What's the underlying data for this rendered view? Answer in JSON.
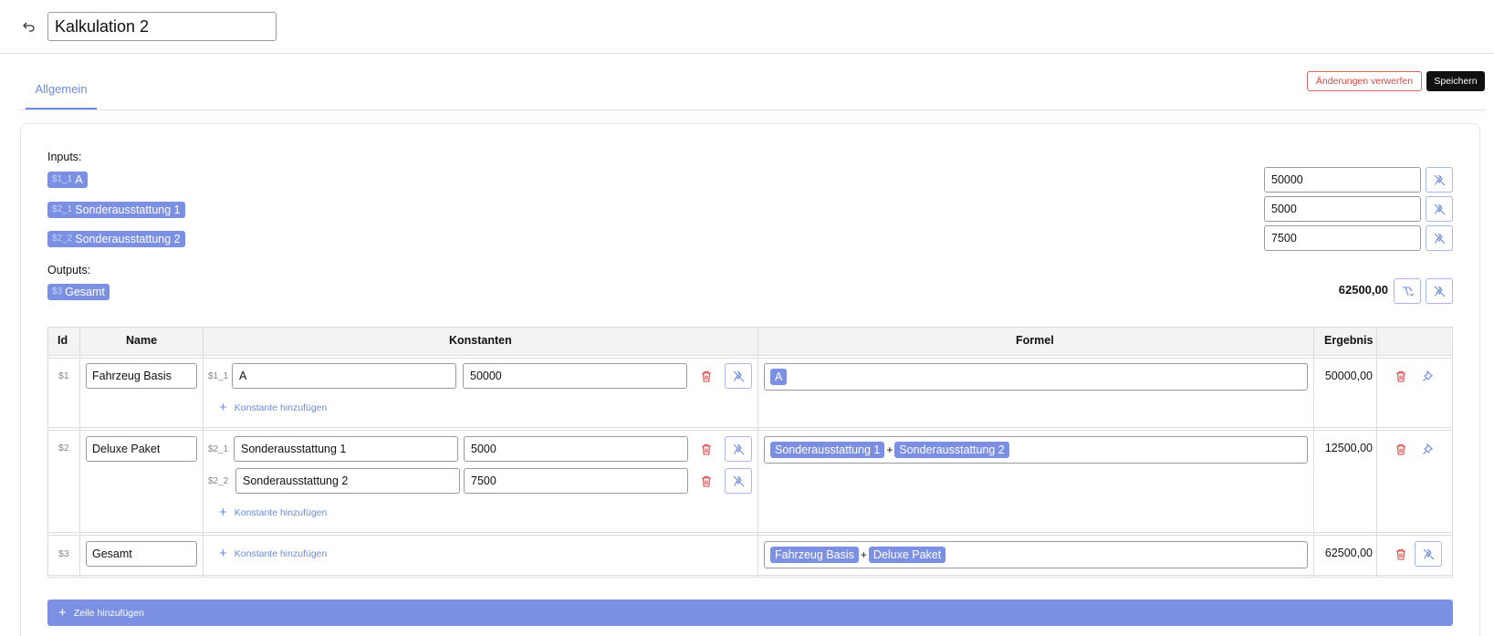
{
  "header": {
    "title_value": "Kalkulation 2"
  },
  "tabs": [
    {
      "label": "Allgemein",
      "active": true
    }
  ],
  "actions": {
    "discard_label": "Änderungen verwerfen",
    "save_label": "Speichern"
  },
  "inputs": {
    "label": "Inputs:",
    "items": [
      {
        "id": "$1_1",
        "name": "A",
        "value": "50000"
      },
      {
        "id": "$2_1",
        "name": "Sonderausstattung 1",
        "value": "5000"
      },
      {
        "id": "$2_2",
        "name": "Sonderausstattung 2",
        "value": "7500"
      }
    ]
  },
  "outputs": {
    "label": "Outputs:",
    "items": [
      {
        "id": "$3",
        "name": "Gesamt",
        "value": "62500,00"
      }
    ]
  },
  "table": {
    "columns": [
      "Id",
      "Name",
      "Konstanten",
      "Formel",
      "Ergebnis"
    ],
    "add_constant_label": "Konstante hinzufügen",
    "rows": [
      {
        "id": "$1",
        "name": "Fahrzeug Basis",
        "constants": [
          {
            "id": "$1_1",
            "name": "A",
            "value": "50000"
          }
        ],
        "formula": [
          {
            "chip": "A"
          }
        ],
        "result": "50000,00"
      },
      {
        "id": "$2",
        "name": "Deluxe Paket",
        "constants": [
          {
            "id": "$2_1",
            "name": "Sonderausstattung 1",
            "value": "5000"
          },
          {
            "id": "$2_2",
            "name": "Sonderausstattung 2",
            "value": "7500"
          }
        ],
        "formula": [
          {
            "chip": "Sonderausstattung 1"
          },
          {
            "op": "+"
          },
          {
            "chip": "Sonderausstattung 2"
          }
        ],
        "result": "12500,00"
      },
      {
        "id": "$3",
        "name": "Gesamt",
        "constants": [],
        "formula": [
          {
            "chip": "Fahrzeug Basis"
          },
          {
            "op": "+"
          },
          {
            "chip": "Deluxe Paket"
          }
        ],
        "result": "62500,00"
      }
    ]
  },
  "add_row_label": "Zeile hinzufügen",
  "colors": {
    "accent": "#7b90e3",
    "tab_accent": "#6c8ae4",
    "danger": "#d44444",
    "save_bg": "#111111"
  },
  "icons": {
    "back": "undo-arrow-icon",
    "unpin": "pin-off-icon",
    "pin": "pin-icon",
    "trash": "trash-icon",
    "flow": "flow-arrow-icon",
    "plus": "plus-icon"
  }
}
